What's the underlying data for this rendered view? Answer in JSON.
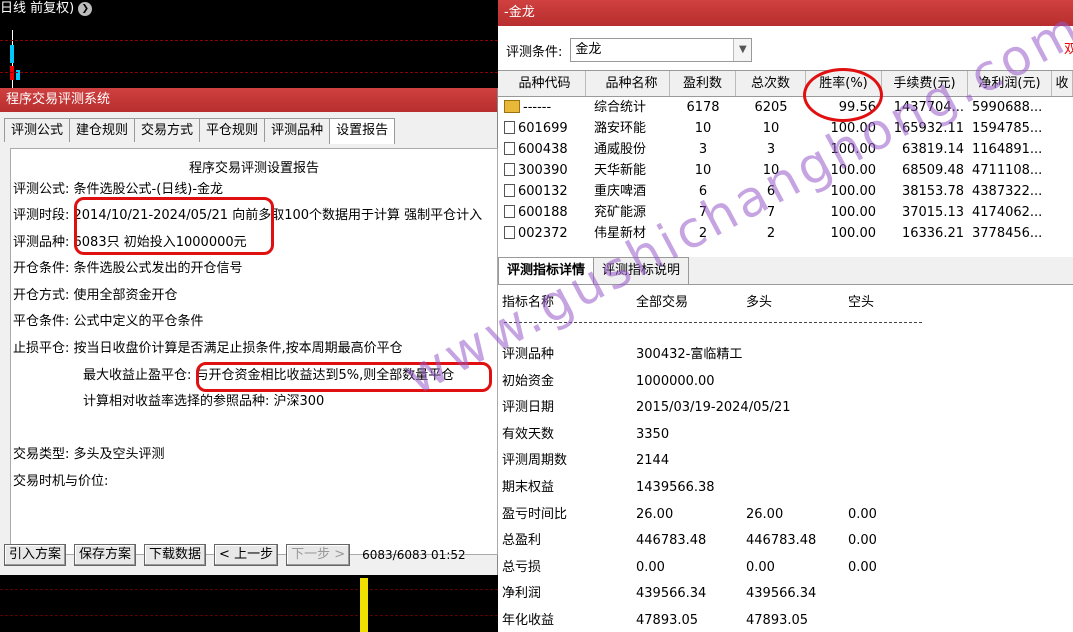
{
  "chart_header": {
    "title": "日线 前复权)",
    "circle_glyph": "❯"
  },
  "left_window": {
    "title": "程序交易评测系统",
    "tabs": [
      "评测公式",
      "建仓规则",
      "交易方式",
      "平仓规则",
      "评测品种",
      "设置报告"
    ],
    "report": {
      "title": "程序交易评测设置报告",
      "lines": [
        "评测公式: 条件选股公式-(日线)-金龙",
        "评测时段: 2014/10/21-2024/05/21 向前多取100个数据用于计算 强制平仓计入",
        "评测品种: 6083只 初始投入1000000元",
        "开仓条件: 条件选股公式发出的开仓信号",
        "开仓方式: 使用全部资金开仓",
        "平仓条件: 公式中定义的平仓条件",
        "止损平仓: 按当日收盘价计算是否满足止损条件,按本周期最高价平仓",
        "最大收益止盈平仓: 与开仓资金相比收益达到5%,则全部数量平仓",
        "计算相对收益率选择的参照品种: 沪深300",
        "交易类型: 多头及空头评测",
        "交易时机与价位:"
      ]
    },
    "buttons": {
      "import": "引入方案",
      "save": "保存方案",
      "download": "下载数据",
      "prev": "< 上一步",
      "next": "下一步 >"
    },
    "status": "6083/6083 01:52"
  },
  "right_window": {
    "title": "-金龙",
    "condition_label": "评测条件:",
    "condition_value": "金龙",
    "red_text": "双",
    "grid": {
      "headers": [
        "品种代码",
        "品种名称",
        "盈利数",
        "总次数",
        "胜率(%)",
        "手续费(元)",
        "净利润(元)",
        "收"
      ],
      "rows": [
        [
          "------",
          "综合统计",
          "6178",
          "6205",
          "99.56",
          "1437704...",
          "5990688..."
        ],
        [
          "601699",
          "潞安环能",
          "10",
          "10",
          "100.00",
          "165932.11",
          "1594785..."
        ],
        [
          "600438",
          "通威股份",
          "3",
          "3",
          "100.00",
          "63819.14",
          "1164891..."
        ],
        [
          "300390",
          "天华新能",
          "10",
          "10",
          "100.00",
          "68509.48",
          "4711108..."
        ],
        [
          "600132",
          "重庆啤酒",
          "6",
          "6",
          "100.00",
          "38153.78",
          "4387322..."
        ],
        [
          "600188",
          "兖矿能源",
          "7",
          "7",
          "100.00",
          "37015.13",
          "4174062..."
        ],
        [
          "002372",
          "伟星新材",
          "2",
          "2",
          "100.00",
          "16336.21",
          "3778456..."
        ]
      ]
    },
    "detail_tabs": [
      "评测指标详情",
      "评测指标说明"
    ],
    "detail": {
      "headers": [
        "指标名称",
        "全部交易",
        "多头",
        "空头"
      ],
      "rows": [
        {
          "k": "评测品种",
          "a": "300432-富临精工",
          "b": "",
          "c": ""
        },
        {
          "k": "初始资金",
          "a": "1000000.00",
          "b": "",
          "c": ""
        },
        {
          "k": "评测日期",
          "a": "2015/03/19-2024/05/21",
          "b": "",
          "c": ""
        },
        {
          "k": "有效天数",
          "a": "3350",
          "b": "",
          "c": ""
        },
        {
          "k": "评测周期数",
          "a": "2144",
          "b": "",
          "c": ""
        },
        {
          "k": "期末权益",
          "a": "1439566.38",
          "b": "",
          "c": ""
        },
        {
          "k": "盈亏时间比",
          "a": "26.00",
          "b": "26.00",
          "c": "0.00"
        },
        {
          "k": "总盈利",
          "a": "446783.48",
          "b": "446783.48",
          "c": "0.00"
        },
        {
          "k": "总亏损",
          "a": "0.00",
          "b": "0.00",
          "c": "0.00"
        },
        {
          "k": "净利润",
          "a": "439566.34",
          "b": "439566.34",
          "c": ""
        },
        {
          "k": "年化收益",
          "a": "47893.05",
          "b": "47893.05",
          "c": ""
        }
      ]
    }
  },
  "watermark": "www.gushichanghong.com",
  "colors": {
    "titlebar": "#c0392b",
    "highlight": "#e01010",
    "watermark": "#9a5ac8"
  }
}
